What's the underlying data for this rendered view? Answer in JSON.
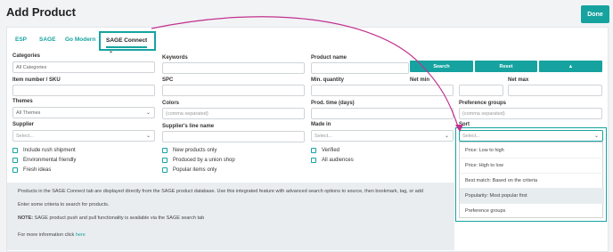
{
  "header": {
    "title": "Add Product",
    "done_label": "Done"
  },
  "tabs": [
    {
      "label": "ESP"
    },
    {
      "label": "SAGE"
    },
    {
      "label": "Go Modern"
    },
    {
      "label": "SAGE Connect",
      "active": true
    }
  ],
  "form": {
    "categories_label": "Categories",
    "categories_value": "All Categories",
    "keywords_label": "Keywords",
    "product_name_label": "Product name",
    "item_number_label": "Item number / SKU",
    "spc_label": "SPC",
    "min_quantity_label": "Min. quantity",
    "net_min_label": "Net min",
    "net_max_label": "Net max",
    "themes_label": "Themes",
    "themes_value": "All Themes",
    "colors_label": "Colors",
    "colors_placeholder": "(comma separated)",
    "prod_time_label": "Prod. time (days)",
    "preference_groups_label": "Preference groups",
    "preference_groups_placeholder": "(comma separated)",
    "supplier_label": "Supplier",
    "supplier_placeholder": "Select...",
    "supplier_line_label": "Supplier's line name",
    "made_in_label": "Made in",
    "made_in_placeholder": "Select...",
    "sort_label": "Sort",
    "sort_placeholder": "Select..."
  },
  "actions": {
    "search_label": "Search",
    "reset_label": "Reset",
    "toggle_label": "▲"
  },
  "checkboxes": {
    "col1": [
      "Include rush shipment",
      "Environmental friendly",
      "Fresh ideas"
    ],
    "col2": [
      "New products only",
      "Produced by a union shop",
      "Popular items only"
    ],
    "col3": [
      "Verified",
      "All audiences"
    ]
  },
  "info": {
    "line1": "Products in the SAGE Connect tab are displayed directly from the SAGE product database. Use this integrated feature with advanced search options to source, then bookmark, tag, or add",
    "line2": "Enter some criteria to search for products.",
    "note_label": "NOTE:",
    "line3": " SAGE product push and pull functionality is available via the SAGE search tab",
    "line4": "For more information click ",
    "link": "here"
  },
  "sort_options": [
    "Price: Low to high",
    "Price: High to low",
    "Best match: Based on the criteria",
    "Popularity: Most popular first",
    "Preference groups"
  ],
  "colors": {
    "accent": "#16a3a0",
    "annotation": "#c2318f"
  }
}
